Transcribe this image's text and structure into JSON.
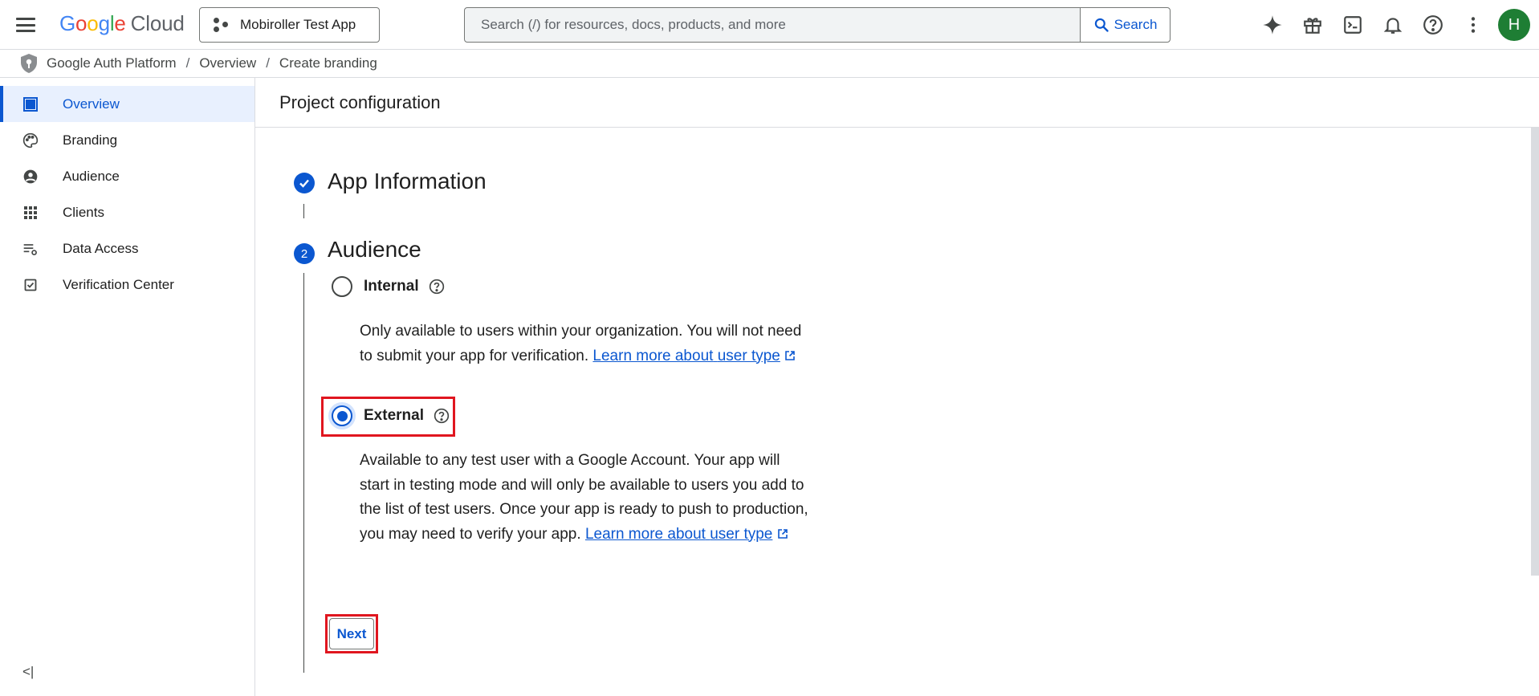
{
  "header": {
    "logo_google": "Google",
    "logo_cloud": "Cloud",
    "project_name": "Mobiroller Test App",
    "search_placeholder": "Search (/) for resources, docs, products, and more",
    "search_button": "Search",
    "avatar_initial": "H",
    "icons": [
      "gemini-sparkle-icon",
      "gift-icon",
      "cloud-shell-icon",
      "notifications-icon",
      "help-icon",
      "more-vert-icon"
    ]
  },
  "breadcrumb": [
    "Google Auth Platform",
    "Overview",
    "Create branding"
  ],
  "sidebar": {
    "items": [
      {
        "label": "Overview",
        "icon": "dashboard-icon",
        "active": true
      },
      {
        "label": "Branding",
        "icon": "palette-icon",
        "active": false
      },
      {
        "label": "Audience",
        "icon": "account-circle-icon",
        "active": false
      },
      {
        "label": "Clients",
        "icon": "apps-grid-icon",
        "active": false
      },
      {
        "label": "Data Access",
        "icon": "data-settings-icon",
        "active": false
      },
      {
        "label": "Verification Center",
        "icon": "checkbox-icon",
        "active": false
      }
    ],
    "collapse_label": "<|"
  },
  "main": {
    "page_title": "Project configuration",
    "steps": [
      {
        "number": "✓",
        "title": "App Information",
        "state": "complete"
      },
      {
        "number": "2",
        "title": "Audience",
        "state": "current"
      }
    ],
    "audience": {
      "options": [
        {
          "label": "Internal",
          "selected": false,
          "description": "Only available to users within your organization. You will not need to submit your app for verification.",
          "link_part1": "Learn more about",
          "link_part2": "user type"
        },
        {
          "label": "External",
          "selected": true,
          "description": "Available to any test user with a Google Account. Your app will start in testing mode and will only be available to users you add to the list of test users. Once your app is ready to push to production, you may need to verify your app.",
          "link_part1": "Learn more about",
          "link_part2": "user type"
        }
      ],
      "next_label": "Next"
    }
  },
  "colors": {
    "accent": "#0b57d0",
    "highlight": "#e0161f",
    "active_nav_bg": "#e8f0fe"
  }
}
